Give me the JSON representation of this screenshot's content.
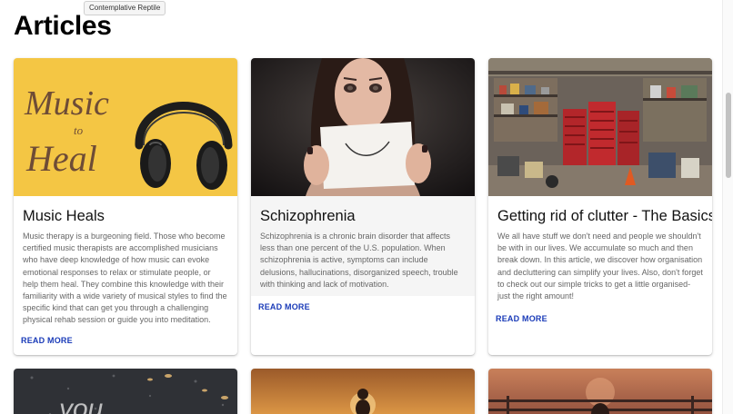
{
  "tooltip": "Contemplative Reptile",
  "page_title": "Articles",
  "cards": [
    {
      "title": "Music Heals",
      "text": "Music therapy is a burgeoning field. Those who become certified music therapists are accomplished musicians who have deep knowledge of how music can evoke emotional responses to relax or stimulate people, or help them heal. They combine this knowledge with their familiarity with a wide variety of musical styles to find the specific kind that can get you through a challenging physical rehab session or guide you into meditation.",
      "action": "READ MORE",
      "image": {
        "type": "music-to-heal-headphones",
        "lettering": [
          "Music",
          "to",
          "Heal"
        ],
        "bg": "#f3c13a",
        "lettering_color": "#6e4c36"
      }
    },
    {
      "title": "Schizophrenia",
      "text": "Schizophrenia is a chronic brain disorder that affects less than one percent of the U.S. population. When schizophrenia is active, symptoms can include delusions, hallucinations, disorganized speech, trouble with thinking and lack of motivation.",
      "action": "READ MORE",
      "image": {
        "type": "woman-holding-smile-paper"
      }
    },
    {
      "title": "Getting rid of clutter - The Basics",
      "text": "We all have stuff we don't need and people we shouldn't be with in our lives. We accumulate so much and then break down. In this article, we discover how organisation and decluttering can simplify your lives. Also, don't forget to check out our simple tricks to get a little organised- just the right amount!",
      "action": "READ MORE",
      "image": {
        "type": "cluttered-garage"
      }
    }
  ],
  "lower_cards": [
    {
      "image": {
        "type": "pavement-you-chalk",
        "lettering": "you"
      }
    },
    {
      "image": {
        "type": "sunset-silhouette"
      }
    },
    {
      "image": {
        "type": "sunset-pier"
      }
    }
  ],
  "colors": {
    "action": "#1a3bb8",
    "title": "#111111",
    "body": "#666666"
  }
}
